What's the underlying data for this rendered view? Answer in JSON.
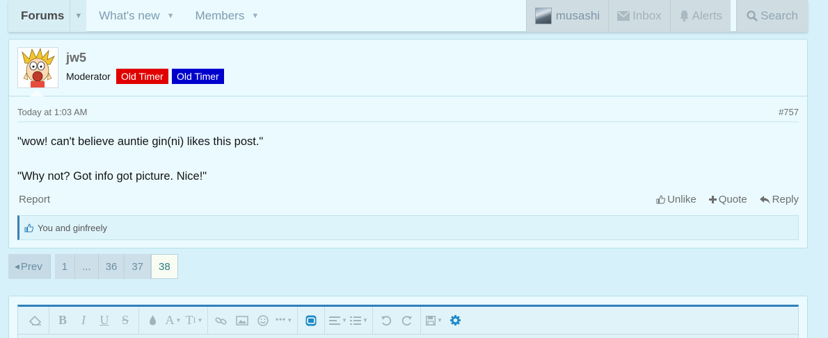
{
  "nav": {
    "tabs": [
      {
        "label": "Forums"
      },
      {
        "label": "What's new"
      },
      {
        "label": "Members"
      }
    ],
    "account": {
      "username": "musashi"
    },
    "inbox_label": "Inbox",
    "alerts_label": "Alerts",
    "search_label": "Search"
  },
  "post": {
    "username": "jw5",
    "user_title": "Moderator",
    "banners": [
      "Old Timer",
      "Old Timer"
    ],
    "timestamp": "Today at 1:03 AM",
    "post_number": "#757",
    "message": [
      "\"wow! can't believe auntie gin(ni) likes this post.\"",
      "\"Why not? Got info got picture. Nice!\""
    ],
    "report_label": "Report",
    "unlike_label": "Unlike",
    "quote_label": "Quote",
    "reply_label": "Reply",
    "likes_text": "You and ginfreely"
  },
  "pagination": {
    "prev_label": "Prev",
    "pages": [
      "1",
      "...",
      "36",
      "37",
      "38"
    ],
    "current": "38"
  },
  "colors": {
    "accent": "#2f7fba",
    "banner_red": "#e00000",
    "banner_blue": "#0000cc"
  }
}
